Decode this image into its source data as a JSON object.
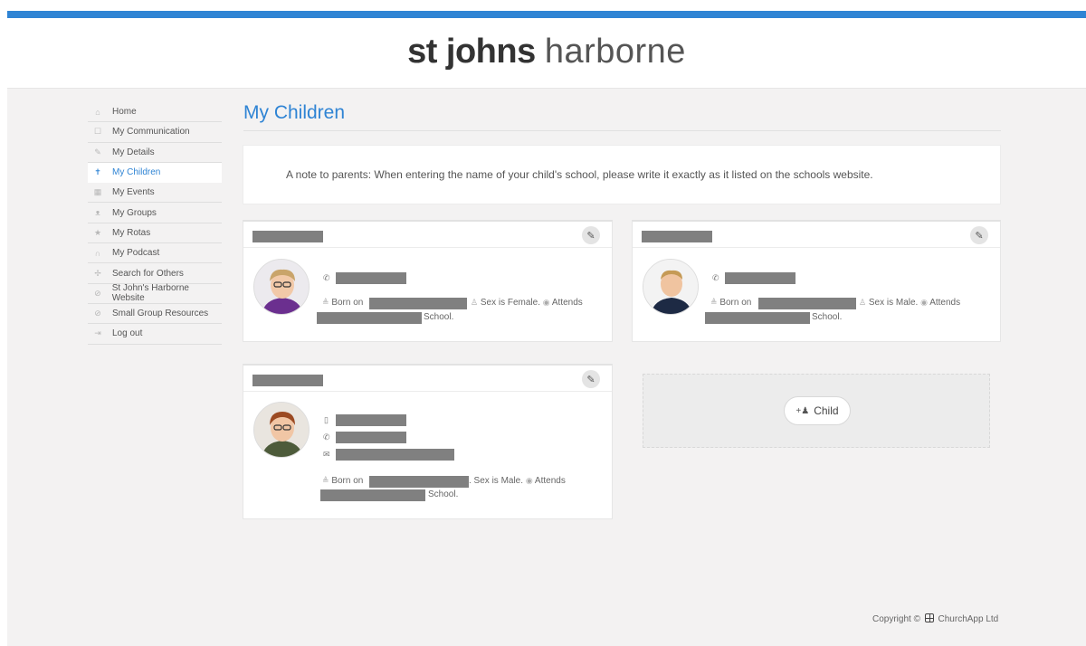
{
  "brand": {
    "bold": "st johns",
    "light": "harborne",
    "accent_color": "#2f84d4"
  },
  "sidebar": {
    "items": [
      {
        "label": "Home",
        "icon": "home-icon",
        "glyph": "⌂"
      },
      {
        "label": "My Communication",
        "icon": "chat-icon",
        "glyph": "☐"
      },
      {
        "label": "My Details",
        "icon": "pencil-icon",
        "glyph": "✎"
      },
      {
        "label": "My Children",
        "icon": "child-icon",
        "glyph": "✝",
        "active": true
      },
      {
        "label": "My Events",
        "icon": "calendar-icon",
        "glyph": "▦"
      },
      {
        "label": "My Groups",
        "icon": "group-icon",
        "glyph": "ᴥ"
      },
      {
        "label": "My Rotas",
        "icon": "star-icon",
        "glyph": "★"
      },
      {
        "label": "My Podcast",
        "icon": "headphones-icon",
        "glyph": "∩"
      },
      {
        "label": "Search for Others",
        "icon": "user-search-icon",
        "glyph": "✢"
      },
      {
        "label": "St John's Harborne Website",
        "icon": "link-icon",
        "glyph": "⊘"
      },
      {
        "label": "Small Group Resources",
        "icon": "link-icon",
        "glyph": "⊘"
      },
      {
        "label": "Log out",
        "icon": "logout-icon",
        "glyph": "⇥"
      }
    ]
  },
  "page": {
    "title": "My Children",
    "note": "A note to parents: When entering the name of your child's school, please write it exactly as it listed on the schools website."
  },
  "children": [
    {
      "born_label": "Born on",
      "sex": "Sex is Female.",
      "attends": "Attends",
      "school_suffix": "School."
    },
    {
      "born_label": "Born on",
      "sex": "Sex is Male.",
      "attends": "Attends",
      "school_suffix": "School."
    },
    {
      "born_label": "Born on",
      "sex": ". Sex is Male.",
      "attends": "Attends",
      "school_suffix": "School."
    }
  ],
  "add_child": {
    "label": "Child"
  },
  "footer": {
    "copyright": "Copyright ©",
    "company": "ChurchApp Ltd"
  }
}
